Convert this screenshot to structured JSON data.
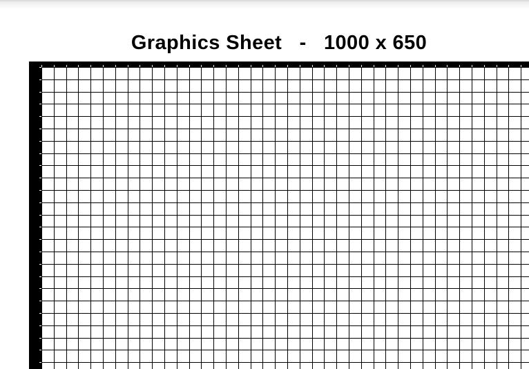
{
  "sheet": {
    "title_name": "Graphics Sheet",
    "title_separator": "-",
    "title_size": "1000 x 650"
  },
  "colors": {
    "border": "#000000",
    "grid_line": "#000000",
    "paper": "#ffffff"
  }
}
